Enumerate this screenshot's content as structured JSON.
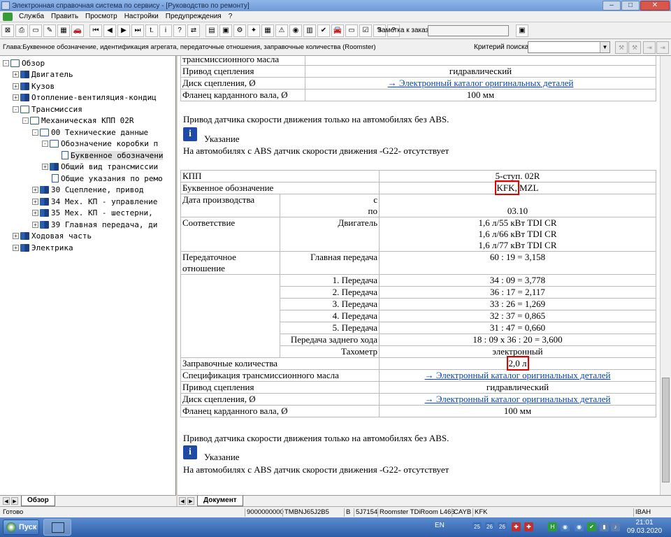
{
  "window": {
    "title": "Электронная справочная система по сервису - [Руководство по ремонту]",
    "buttons": {
      "minimize": "–",
      "maximize": "□",
      "close": "✕"
    }
  },
  "menu": [
    "Служба",
    "Править",
    "Просмотр",
    "Настройки",
    "Предупреждения",
    "?"
  ],
  "toolbar": {
    "order_label": "Заметка к заказу:",
    "order_value": "",
    "group1": [
      "⊠",
      "⎙",
      "▭",
      "✎",
      "▦",
      "🚗"
    ],
    "group2": [
      "⏮",
      "◀",
      "▶",
      "⏭",
      "t.",
      "i",
      "?",
      "⇄"
    ],
    "group3": [
      "▤",
      "▣",
      "⚙",
      "✦",
      "▦",
      "⚠",
      "◉",
      "▥",
      "✔",
      "🚘",
      "▭",
      "☑",
      "✎",
      "?"
    ],
    "order_btn": "▣"
  },
  "chapter": {
    "text": "Глава:Буквенное обозначение, идентификация агрегата, передаточные отношения, заправочные количества (Roomster)",
    "search_label": "Критерий поиска:",
    "search_value": "",
    "search_arrow": "▼",
    "search_btns": [
      "⚒",
      "⚒",
      "⇥",
      "⇥"
    ]
  },
  "tree": {
    "items": [
      {
        "label": "Обзор",
        "exp": "-"
      },
      {
        "label": "Двигатель",
        "exp": "+"
      },
      {
        "label": "Кузов",
        "exp": "+"
      },
      {
        "label": "Отопление-вентиляция-кондиц",
        "exp": "+"
      },
      {
        "label": "Трансмиссия",
        "exp": "-"
      },
      {
        "label": "Механическая КПП 02R",
        "exp": "-"
      },
      {
        "label": "00 Технические данные",
        "exp": "-"
      },
      {
        "label": "Обозначение коробки п",
        "exp": "-"
      },
      {
        "label": "Буквенное обозначени",
        "exp": ""
      },
      {
        "label": "Общий вид трансмиссии",
        "exp": "+"
      },
      {
        "label": "Общие указания по ремо",
        "exp": ""
      },
      {
        "label": "30 Сцепление, привод",
        "exp": "+"
      },
      {
        "label": "34 Мех. КП - управление",
        "exp": "+"
      },
      {
        "label": "35 Мех. КП - шестерни,",
        "exp": "+"
      },
      {
        "label": "39 Главная передача, ди",
        "exp": "+"
      },
      {
        "label": "Ходовая часть",
        "exp": "+"
      },
      {
        "label": "Электрика",
        "exp": "+"
      }
    ]
  },
  "content": {
    "top_table": {
      "rows": [
        {
          "label": "трансмиссионного масла",
          "value": ""
        },
        {
          "label": "Привод сцепления",
          "value": "гидравлический"
        },
        {
          "label": "Диск сцепления, Ø",
          "value": "→ Электронный каталог оригинальных деталей"
        },
        {
          "label": "Фланец карданного вала, Ø",
          "value": "100 мм"
        }
      ]
    },
    "para1": "Привод датчика скорости движения только на автомобилях без ABS.",
    "note_icon": "i",
    "note_title": "Указание",
    "note_text": "На автомобилях с ABS датчик скорости движения -G22- отсутствует",
    "main_table": {
      "kpp_label": "КПП",
      "kpp_value": "5-ступ. 02R",
      "code_label": "Буквенное обозначение",
      "code_a": "KFK,",
      "code_b": " MZL",
      "date_label": "Дата производства",
      "date_from": "с",
      "date_to": "по",
      "date_value": "03.10",
      "match_label": "Соответствие",
      "engine_label": "Двигатель",
      "engines": [
        "1,6 л/55 кВт TDI CR",
        "1,6 л/66 кВт TDI CR",
        "1,6 л/77 кВт TDI CR"
      ],
      "ratio_label": "Передаточное отношение",
      "main_gear_label": "Главная передача",
      "main_gear_value": "60 : 19 = 3,158",
      "gears": [
        {
          "label": "1. Передача",
          "value": "34 : 09 = 3,778"
        },
        {
          "label": "2. Передача",
          "value": "36 : 17 = 2,117"
        },
        {
          "label": "3. Передача",
          "value": "33 : 26 = 1,269"
        },
        {
          "label": "4. Передача",
          "value": "32 : 37 = 0,865"
        },
        {
          "label": "5. Передача",
          "value": "31 : 47 = 0,660"
        },
        {
          "label": "Передача заднего хода",
          "value": "18 : 09 x 36 : 20 = 3,600"
        }
      ],
      "tacho_label": "Тахометр",
      "tacho_value": "электронный",
      "fill_label": "Заправочные количества",
      "fill_value": "2,0 л",
      "oil_label": "Спецификация трансмиссионного масла",
      "oil_value": "→ Электронный каталог оригинальных деталей",
      "clutch_label": "Привод сцепления",
      "clutch_value": "гидравлический",
      "disc_label": "Диск сцепления, Ø",
      "disc_value": "→ Электронный каталог оригинальных деталей",
      "flange_label": "Фланец карданного вала, Ø",
      "flange_value": "100 мм"
    },
    "para2": "Привод датчика скорости движения только на автомобилях без ABS.",
    "note2_icon": "i",
    "note2_title": "Указание",
    "note2_text": "На автомобилях с ABS датчик скорости движения -G22- отсутствует"
  },
  "tabs": {
    "left": "Обзор",
    "right": "Документ",
    "arrows": [
      "◀",
      "▶"
    ]
  },
  "status": {
    "ready": "Готово",
    "fields": [
      "9000000000",
      "TMBNJ65J2B5",
      "B",
      "5J7154",
      "Roomster TDiRoom L466",
      "CAYB",
      "KFK",
      "IBAH"
    ]
  },
  "taskbar": {
    "start": "Пуск",
    "lang": "EN",
    "tray": [
      {
        "text": "25",
        "color": "#3c6fc0"
      },
      {
        "text": "26",
        "color": "#3c6fc0"
      },
      {
        "text": "26",
        "color": "#3c6fc0"
      },
      {
        "text": "✚",
        "color": "#c03030"
      },
      {
        "text": "✚",
        "color": "#c03030"
      },
      {
        "text": "H",
        "color": "#2e9a3e"
      },
      {
        "text": "◉",
        "color": "#4a7fc8"
      },
      {
        "text": "◉",
        "color": "#4a7fc8"
      },
      {
        "text": "✔",
        "color": "#2e9a3e"
      },
      {
        "text": "▮",
        "color": "#5a7fb0"
      },
      {
        "text": "♪",
        "color": "#5a7fb0"
      }
    ],
    "time": "21:01",
    "date": "09.03.2020"
  }
}
